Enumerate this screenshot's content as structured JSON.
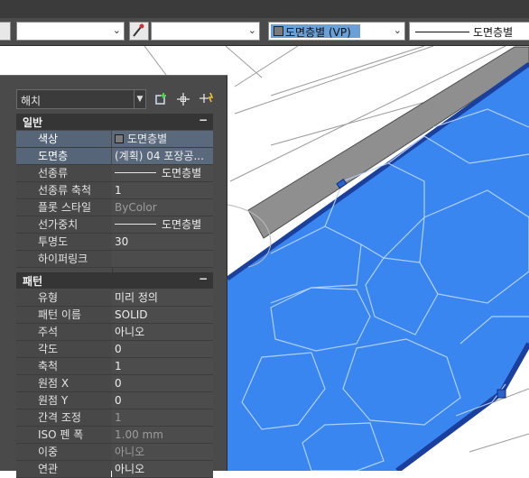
{
  "toolbar": {
    "layer_name": "도면층별 (VP)",
    "linetype_name": "도면층별"
  },
  "palette": {
    "object_type": "해치",
    "sections": [
      {
        "title": "일반",
        "collapse_symbol": "−",
        "rows": [
          {
            "label": "색상",
            "value": "도면층별",
            "kind": "color"
          },
          {
            "label": "도면층",
            "value": "(계획) 04 포장공...",
            "kind": "text"
          },
          {
            "label": "선종류",
            "value": "도면층별",
            "kind": "linetype"
          },
          {
            "label": "선종류 축척",
            "value": "1",
            "kind": "text"
          },
          {
            "label": "플롯 스타일",
            "value": "ByColor",
            "kind": "dim"
          },
          {
            "label": "선가중치",
            "value": "도면층별",
            "kind": "linetype"
          },
          {
            "label": "투명도",
            "value": "30",
            "kind": "text"
          },
          {
            "label": "하이퍼링크",
            "value": "",
            "kind": "text"
          }
        ]
      },
      {
        "title": "패턴",
        "collapse_symbol": "−",
        "rows": [
          {
            "label": "유형",
            "value": "미리 정의",
            "kind": "text"
          },
          {
            "label": "패턴 이름",
            "value": "SOLID",
            "kind": "text"
          },
          {
            "label": "주석",
            "value": "아니오",
            "kind": "text"
          },
          {
            "label": "각도",
            "value": "0",
            "kind": "text"
          },
          {
            "label": "축척",
            "value": "1",
            "kind": "text"
          },
          {
            "label": "원점 X",
            "value": "0",
            "kind": "text"
          },
          {
            "label": "원점 Y",
            "value": "0",
            "kind": "text"
          },
          {
            "label": "간격 조정",
            "value": "1",
            "kind": "dim"
          },
          {
            "label": "ISO 펜 폭",
            "value": "1.00 mm",
            "kind": "dim"
          },
          {
            "label": "이중",
            "value": "아니오",
            "kind": "dim"
          },
          {
            "label": "연관",
            "value": "아니오",
            "kind": "text"
          }
        ]
      }
    ]
  },
  "colors": {
    "hatch_fill": "#3a86f0",
    "hatch_edge": "#1c4fb8",
    "wall_gray": "#8c8c8c",
    "palette_bg": "#4a4a4a",
    "selected_row": "#566577"
  }
}
